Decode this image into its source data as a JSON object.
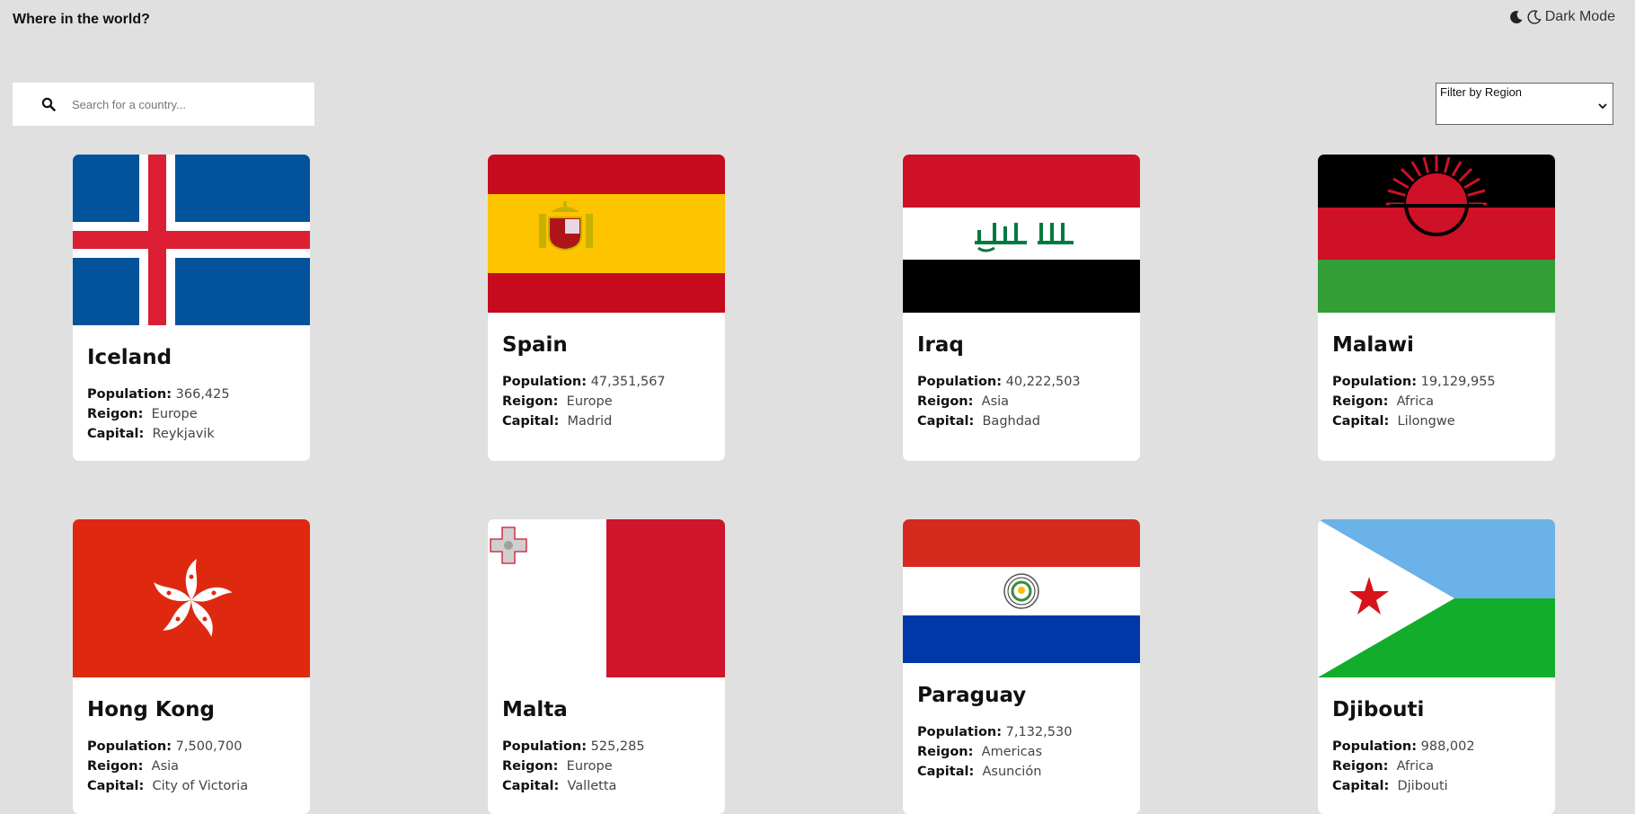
{
  "header": {
    "title": "Where in the world?",
    "theme_toggle_label": "Dark Mode"
  },
  "search": {
    "placeholder": "Search for a country...",
    "value": ""
  },
  "filter": {
    "label": "Filter by Region"
  },
  "labels": {
    "population": "Population:",
    "region": "Reigon:",
    "capital": "Capital:"
  },
  "countries": [
    {
      "name": "Iceland",
      "population": "366,425",
      "region": "Europe",
      "capital": "Reykjavik",
      "flag": "iceland-flag"
    },
    {
      "name": "Spain",
      "population": "47,351,567",
      "region": "Europe",
      "capital": "Madrid",
      "flag": "spain-flag"
    },
    {
      "name": "Iraq",
      "population": "40,222,503",
      "region": "Asia",
      "capital": "Baghdad",
      "flag": "iraq-flag"
    },
    {
      "name": "Malawi",
      "population": "19,129,955",
      "region": "Africa",
      "capital": "Lilongwe",
      "flag": "malawi-flag"
    },
    {
      "name": "Hong Kong",
      "population": "7,500,700",
      "region": "Asia",
      "capital": "City of Victoria",
      "flag": "hong-kong-flag"
    },
    {
      "name": "Malta",
      "population": "525,285",
      "region": "Europe",
      "capital": "Valletta",
      "flag": "malta-flag"
    },
    {
      "name": "Paraguay",
      "population": "7,132,530",
      "region": "Americas",
      "capital": "Asunción",
      "flag": "paraguay-flag"
    },
    {
      "name": "Djibouti",
      "population": "988,002",
      "region": "Africa",
      "capital": "Djibouti",
      "flag": "djibouti-flag"
    }
  ],
  "colors": {
    "page_background": "#e0e0e0",
    "card_background": "#ffffff"
  }
}
